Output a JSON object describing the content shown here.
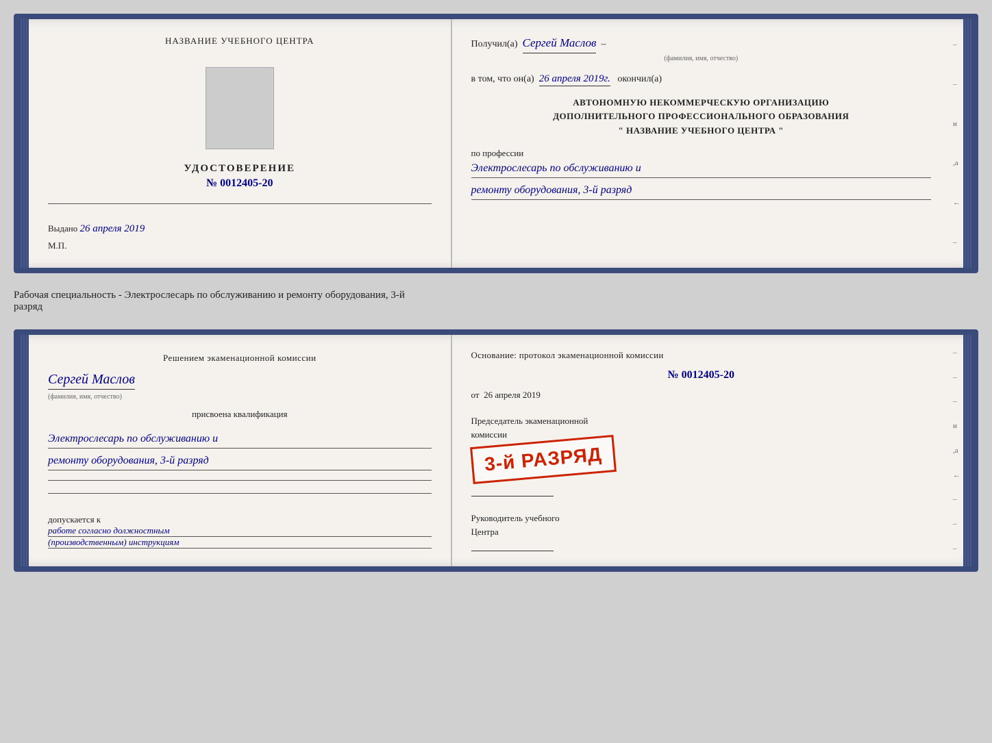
{
  "page": {
    "background": "#d0d0d0"
  },
  "top_doc": {
    "left": {
      "title": "НАЗВАНИЕ УЧЕБНОГО ЦЕНТРА",
      "cert_label": "УДОСТОВЕРЕНИЕ",
      "cert_number": "№ 0012405-20",
      "issued_label": "Выдано",
      "issued_date": "26 апреля 2019",
      "mp_label": "М.П."
    },
    "right": {
      "received_prefix": "Получил(а)",
      "recipient_name": "Сергей Маслов",
      "fio_label": "(фамилия, имя, отчество)",
      "date_prefix": "в том, что он(а)",
      "date_value": "26 апреля 2019г.",
      "date_suffix": "окончил(а)",
      "org_line1": "АВТОНОМНУЮ НЕКОММЕРЧЕСКУЮ ОРГАНИЗАЦИЮ",
      "org_line2": "ДОПОЛНИТЕЛЬНОГО ПРОФЕССИОНАЛЬНОГО ОБРАЗОВАНИЯ",
      "org_line3": "\" НАЗВАНИЕ УЧЕБНОГО ЦЕНТРА \"",
      "profession_label": "по профессии",
      "profession_line1": "Электрослесарь по обслуживанию и",
      "profession_line2": "ремонту оборудования, 3-й разряд"
    }
  },
  "middle_text": "Рабочая специальность - Электрослесарь по обслуживанию и ремонту оборудования, 3-й\nразряд",
  "bottom_doc": {
    "left": {
      "commission_title": "Решением экаменационной комиссии",
      "person_name": "Сергей Маслов",
      "fio_label": "(фамилия, имя, отчество)",
      "kvalif_label": "присвоена квалификация",
      "kvalif_line1": "Электрослесарь по обслуживанию и",
      "kvalif_line2": "ремонту оборудования, 3-й разряд",
      "allowed_label": "допускается к",
      "allowed_text": "работе согласно должностным",
      "allowed_text2": "(производственным) инструкциям"
    },
    "right": {
      "osnov_label": "Основание: протокол экаменационной комиссии",
      "osnov_number": "№ 0012405-20",
      "date_prefix": "от",
      "date_value": "26 апреля 2019",
      "stamp_text": "3-й РАЗРЯД",
      "predsedatel_label": "Председатель экаменационной",
      "predsedatel_label2": "комиссии",
      "rukov_label": "Руководитель учебного",
      "rukov_label2": "Центра"
    }
  },
  "side_marks": [
    "-",
    "-",
    "-",
    "и",
    ",а",
    "←",
    "-",
    "-",
    "-"
  ]
}
